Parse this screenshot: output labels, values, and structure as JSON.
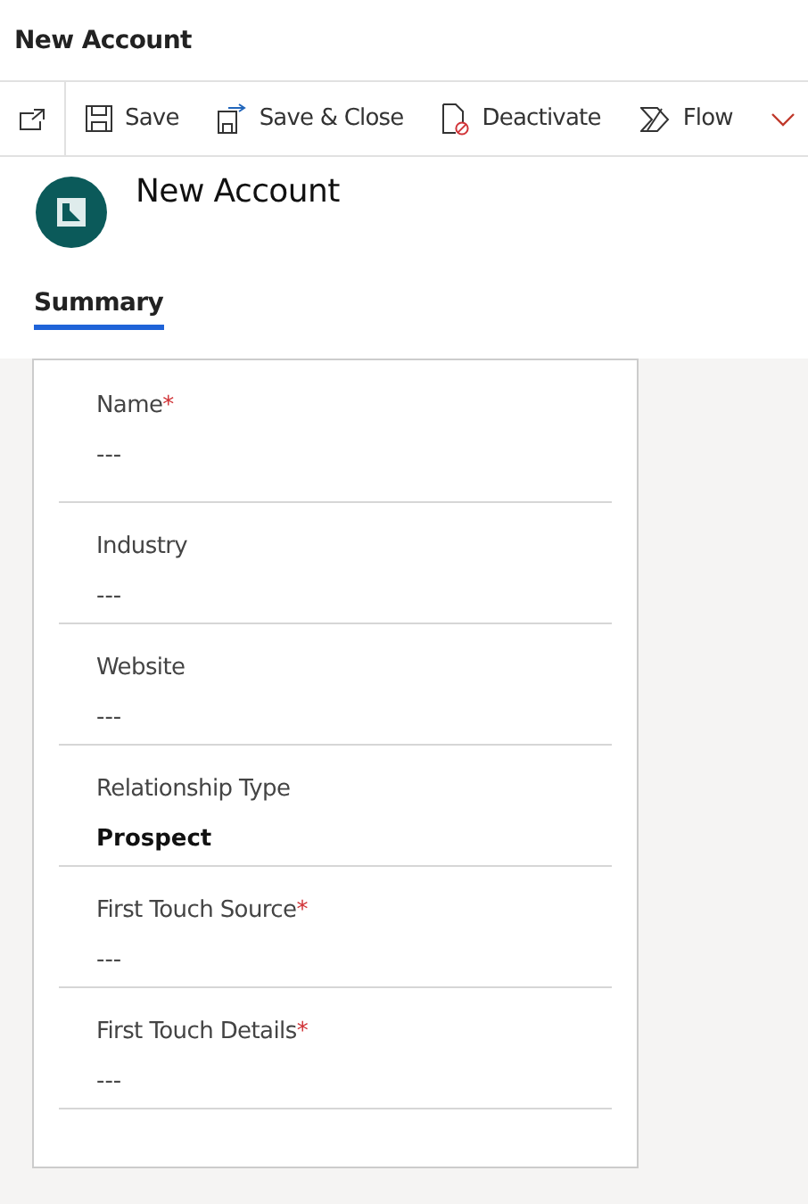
{
  "window": {
    "title": "New Account"
  },
  "toolbar": [
    {
      "kind": "popout"
    },
    {
      "kind": "save",
      "label": "Save"
    },
    {
      "kind": "save-close",
      "label": "Save & Close"
    },
    {
      "kind": "deactivate",
      "label": "Deactivate"
    },
    {
      "kind": "flow",
      "label": "Flow"
    },
    {
      "kind": "more"
    }
  ],
  "header": {
    "title": "New Account"
  },
  "tabs": [
    {
      "label": "Summary",
      "selected": true
    }
  ],
  "fields": [
    {
      "label": "Name",
      "marker": "*",
      "value": "---",
      "set": false
    },
    {
      "label": "Industry",
      "value": "---",
      "set": false
    },
    {
      "label": "Website",
      "value": "---",
      "set": false
    },
    {
      "label": "Relationship Type",
      "value": "Prospect",
      "set": true
    },
    {
      "label": "First Touch Source",
      "marker": "*",
      "value": "---",
      "set": false
    },
    {
      "label": "First Touch Details",
      "marker": "*",
      "value": "---",
      "set": false
    }
  ]
}
